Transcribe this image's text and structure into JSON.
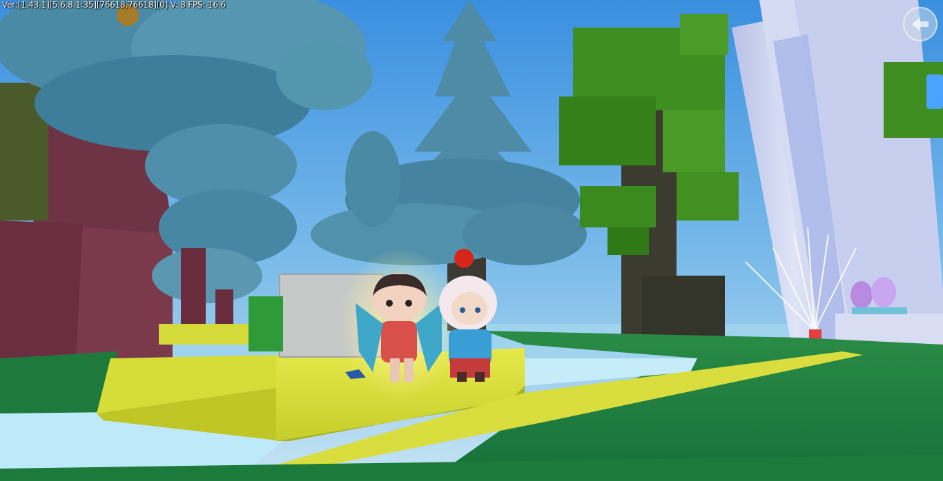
{
  "hud": {
    "debug_text": "Ver:[1.43.1][5.6.8.1:35][76618,76618][0] V: 8 FPS: 16.6",
    "back_button_icon": "back-arrow-icon"
  },
  "colors": {
    "sky_top": "#3f96e4",
    "sky_bottom": "#b9dcf2",
    "foliage_blue": "#4a8aa6",
    "foliage_green": "#3d8a1e",
    "trunk_dark": "#3a3327",
    "trunk_red": "#7a3648",
    "yellow_block": "#d8de3a",
    "grass": "#1f7c3c",
    "water": "#b6e6f8",
    "tower": "#cdd6f0"
  }
}
